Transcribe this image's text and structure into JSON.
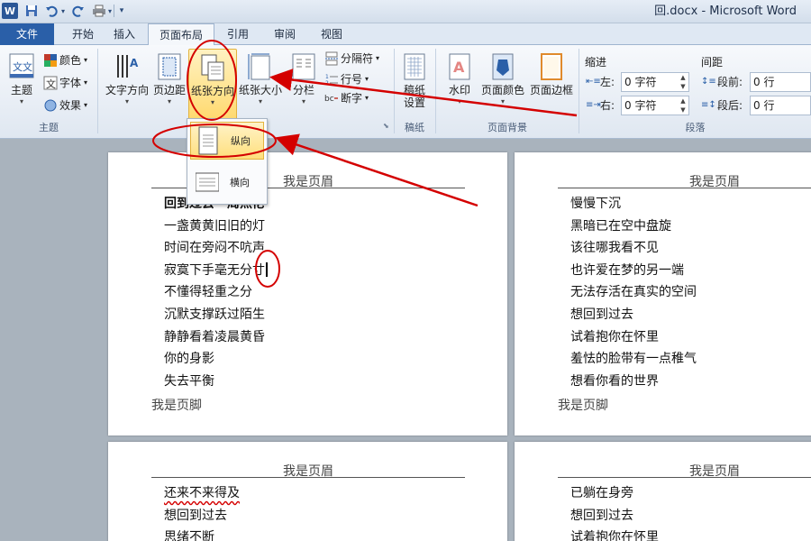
{
  "title_bar": {
    "app_logo": "W",
    "window_title": "回.docx - Microsoft Word"
  },
  "tabs": {
    "file": "文件",
    "items": [
      "开始",
      "插入",
      "页面布局",
      "引用",
      "审阅",
      "视图"
    ],
    "active": "页面布局"
  },
  "ribbon": {
    "theme_group": {
      "label": "主题",
      "themes_button": "主题",
      "colors_button": "颜色",
      "fonts_button": "字体",
      "effects_button": "效果"
    },
    "page_setup_group": {
      "text_direction": "文字方向",
      "margins": "页边距",
      "orientation": "纸张方向",
      "size": "纸张大小",
      "columns": "分栏",
      "breaks": "分隔符",
      "line_numbers": "行号",
      "hyphenation": "断字"
    },
    "manuscript_group": {
      "label": "稿纸",
      "manuscript_settings_line1": "稿纸",
      "manuscript_settings_line2": "设置"
    },
    "page_background_group": {
      "label": "页面背景",
      "watermark": "水印",
      "page_color": "页面颜色",
      "page_borders": "页面边框"
    },
    "paragraph_group": {
      "label": "段落",
      "indent_title": "缩进",
      "spacing_title": "间距",
      "indent_left_label": "左:",
      "indent_left_value": "0 字符",
      "indent_right_label": "右:",
      "indent_right_value": "0 字符",
      "spacing_before_label": "段前:",
      "spacing_before_value": "0 行",
      "spacing_after_label": "段后:",
      "spacing_after_value": "0 行"
    }
  },
  "orientation_menu": {
    "portrait": "纵向",
    "landscape": "横向"
  },
  "pages": [
    {
      "header": "我是页眉",
      "lines": [
        "回到过去一周杰伦",
        "一盏黄黄旧旧的灯",
        "时间在旁闷不吭声",
        "寂寞下手毫无分寸",
        "不懂得轻重之分",
        "沉默支撑跃过陌生",
        "静静看着凌晨黄昏",
        "你的身影",
        "失去平衡"
      ],
      "footer": "我是页脚"
    },
    {
      "header": "我是页眉",
      "lines": [
        "慢慢下沉",
        "黑暗已在空中盘旋",
        "该往哪我看不见",
        "也许爱在梦的另一端",
        "无法存活在真实的空间",
        "想回到过去",
        "试着抱你在怀里",
        "羞怯的脸带有一点稚气",
        "想看你看的世界"
      ],
      "footer": "我是页脚"
    },
    {
      "header": "我是页眉",
      "lines": [
        "还来不来得及",
        "想回到过去",
        "思绪不断"
      ]
    },
    {
      "header": "我是页眉",
      "lines": [
        "已躺在身旁",
        "想回到过去",
        "试着抱你在怀里"
      ]
    }
  ],
  "colors": {
    "file_tab": "#2a5fa8",
    "highlight": "#ffd96e",
    "annotation": "#d40000",
    "workspace": "#a9b3bd"
  }
}
